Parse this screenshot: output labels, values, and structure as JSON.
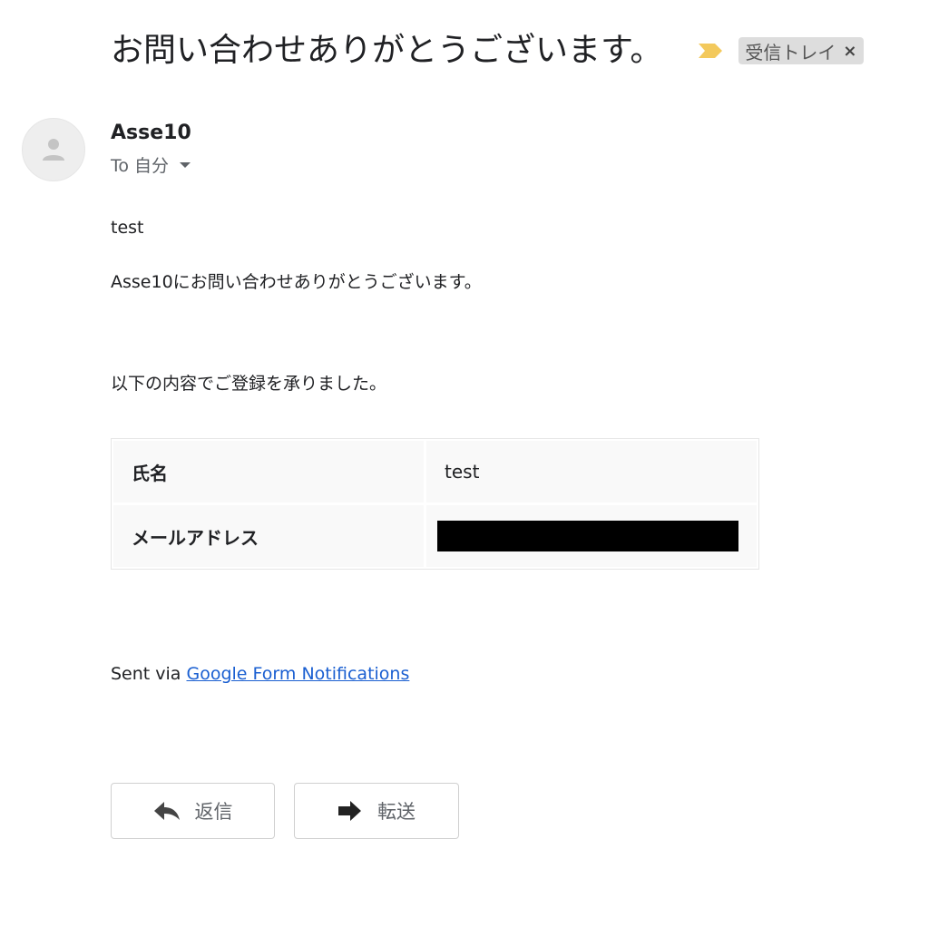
{
  "subject": "お問い合わせありがとうございます。",
  "label": {
    "name": "受信トレイ",
    "remove": "×"
  },
  "icons": {
    "avatar": "person-icon",
    "importance": "importance-marker-icon",
    "reply": "reply-icon",
    "forward": "forward-icon"
  },
  "colors": {
    "importance": "#f3c95c",
    "link": "#1a5fd1"
  },
  "sender": {
    "name": "Asse10",
    "recipient": "To 自分"
  },
  "body": {
    "line1": "test",
    "line2": "Asse10にお問い合わせありがとうございます。",
    "line3": "以下の内容でご登録を承りました。"
  },
  "table": {
    "rows": [
      {
        "key": "氏名",
        "value": "test"
      },
      {
        "key": "メールアドレス",
        "value": ""
      }
    ]
  },
  "footer": {
    "prefix": "Sent via ",
    "link": "Google Form Notifications"
  },
  "actions": {
    "reply": "返信",
    "forward": "転送"
  }
}
